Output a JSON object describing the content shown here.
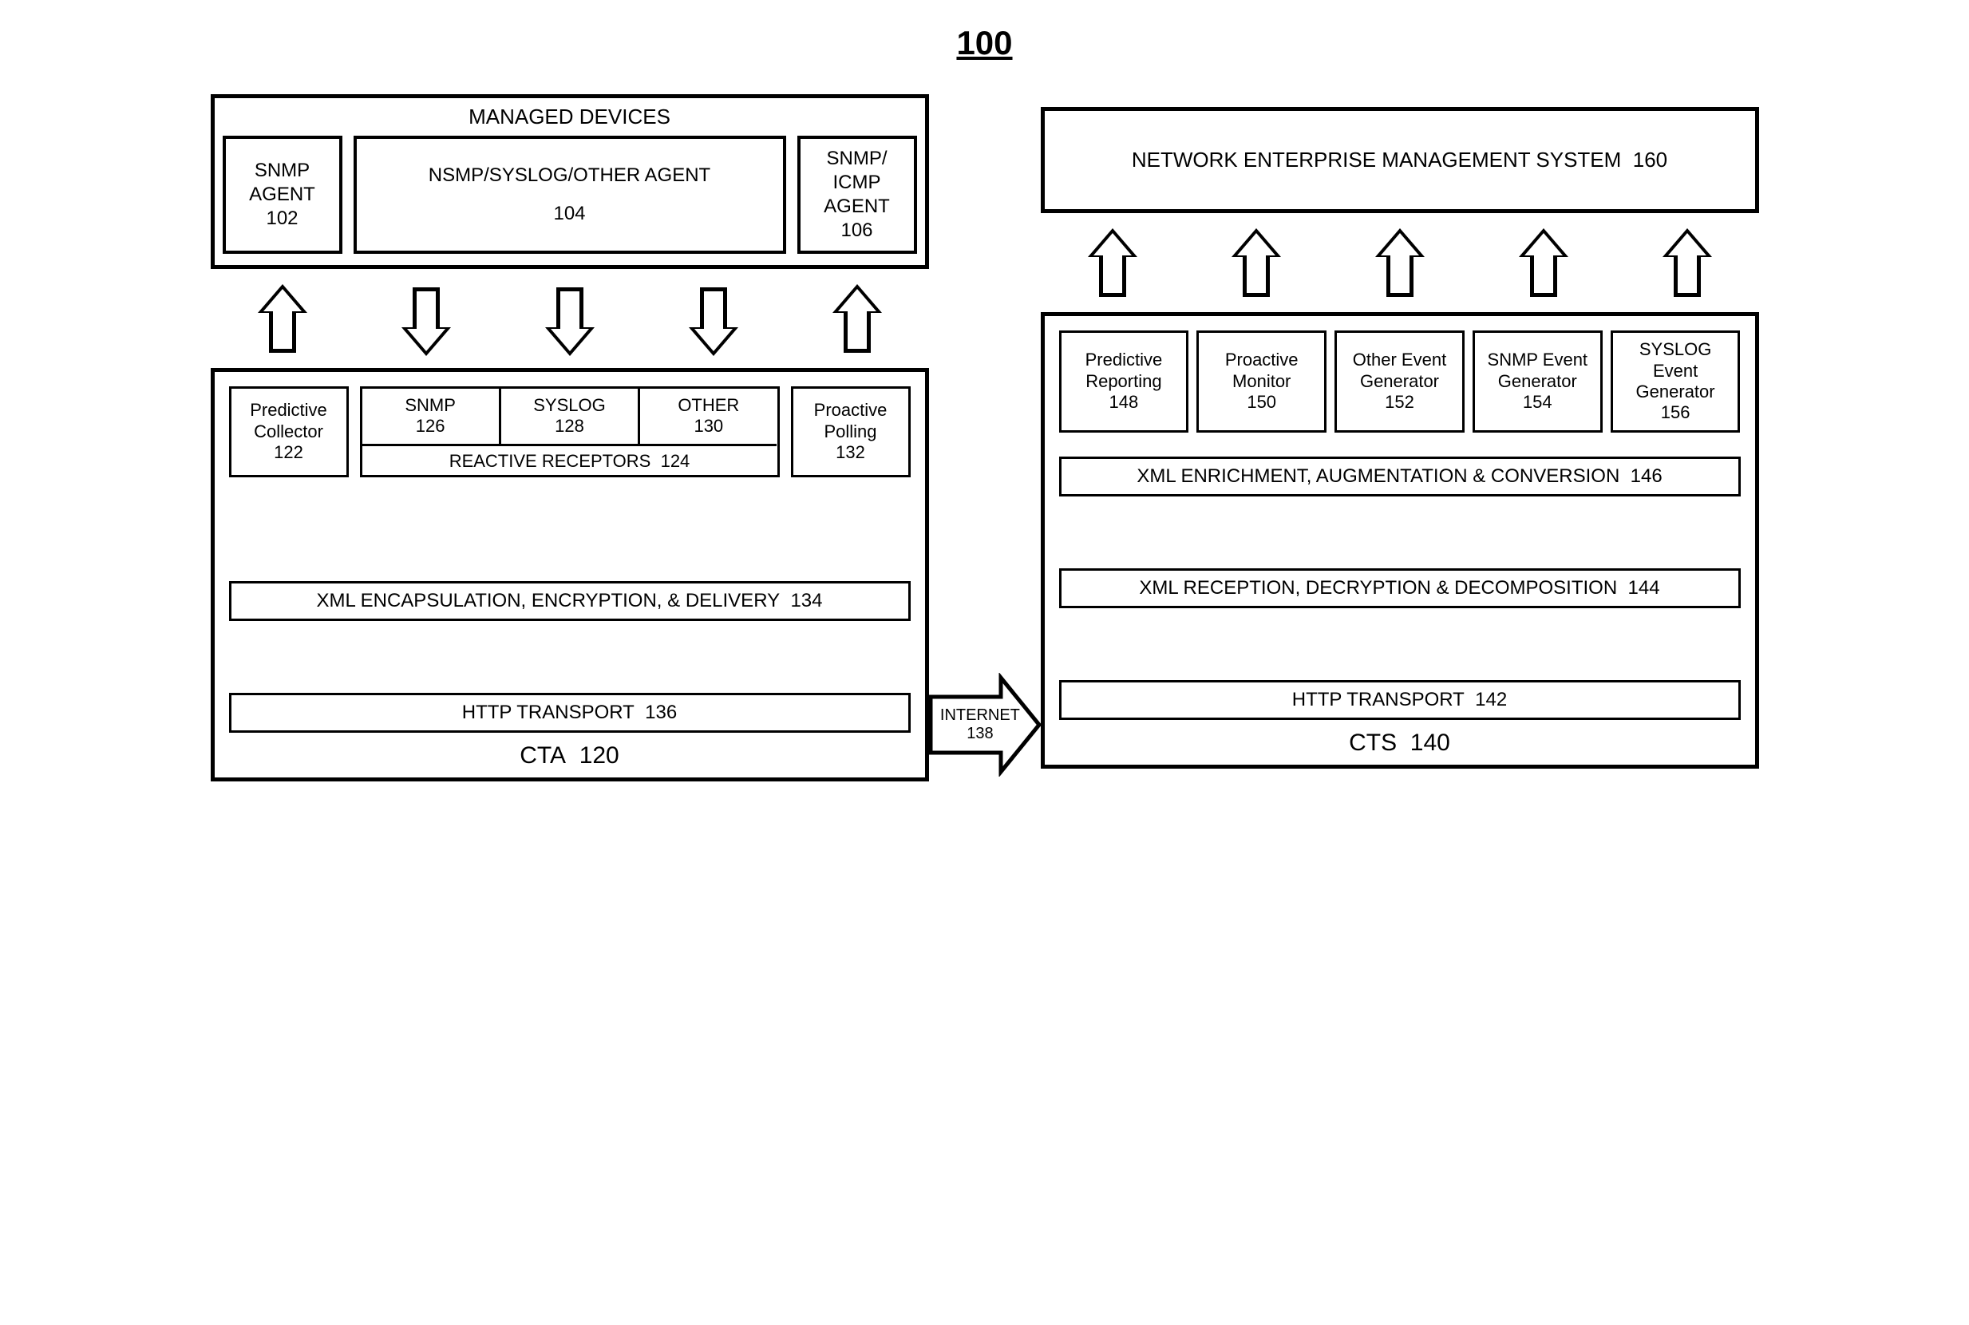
{
  "figure_id": "100",
  "left": {
    "managed_devices": {
      "title": "MANAGED DEVICES",
      "snmp_agent": {
        "label": "SNMP AGENT",
        "ref": "102"
      },
      "nsmp_syslog_other_agent": {
        "label": "NSMP/SYSLOG/OTHER AGENT",
        "ref": "104"
      },
      "snmp_icmp_agent": {
        "label": "SNMP/ ICMP AGENT",
        "ref": "106"
      }
    },
    "cta": {
      "label": "CTA",
      "ref": "120",
      "predictive_collector": {
        "label": "Predictive Collector",
        "ref": "122"
      },
      "reactive_receptors": {
        "label": "REACTIVE RECEPTORS",
        "ref": "124",
        "snmp": {
          "label": "SNMP",
          "ref": "126"
        },
        "syslog": {
          "label": "SYSLOG",
          "ref": "128"
        },
        "other": {
          "label": "OTHER",
          "ref": "130"
        }
      },
      "proactive_polling": {
        "label": "Proactive Polling",
        "ref": "132"
      },
      "xml_encapsulation": {
        "label": "XML ENCAPSULATION, ENCRYPTION, & DELIVERY",
        "ref": "134"
      },
      "http_transport": {
        "label": "HTTP TRANSPORT",
        "ref": "136"
      }
    }
  },
  "middle": {
    "internet": {
      "label": "INTERNET",
      "ref": "138"
    }
  },
  "right": {
    "nems": {
      "label": "NETWORK ENTERPRISE MANAGEMENT SYSTEM",
      "ref": "160"
    },
    "cts": {
      "label": "CTS",
      "ref": "140",
      "predictive_reporting": {
        "label": "Predictive Reporting",
        "ref": "148"
      },
      "proactive_monitor": {
        "label": "Proactive Monitor",
        "ref": "150"
      },
      "other_event_generator": {
        "label": "Other Event Generator",
        "ref": "152"
      },
      "snmp_event_generator": {
        "label": "SNMP Event Generator",
        "ref": "154"
      },
      "syslog_event_generator": {
        "label": "SYSLOG Event Generator",
        "ref": "156"
      },
      "xml_enrichment": {
        "label": "XML ENRICHMENT, AUGMENTATION & CONVERSION",
        "ref": "146"
      },
      "xml_reception": {
        "label": "XML RECEPTION, DECRYPTION & DECOMPOSITION",
        "ref": "144"
      },
      "http_transport": {
        "label": "HTTP TRANSPORT",
        "ref": "142"
      }
    }
  }
}
